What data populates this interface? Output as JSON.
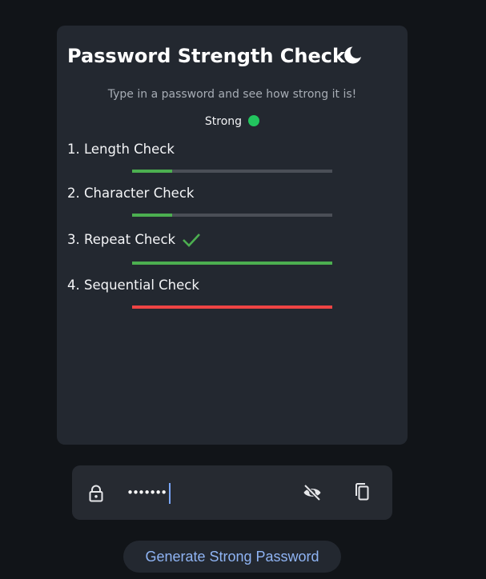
{
  "card": {
    "title": "Password Strength Check",
    "subtitle": "Type in a password and see how strong it is!",
    "strength": {
      "label": "Strong",
      "color": "#22c55e"
    },
    "checks": [
      {
        "label": "1. Length Check",
        "progress": 0.2,
        "color": "#4caf50",
        "passed": false
      },
      {
        "label": "2. Character Check",
        "progress": 0.2,
        "color": "#4caf50",
        "passed": false
      },
      {
        "label": "3. Repeat Check",
        "progress": 1.0,
        "color": "#4caf50",
        "passed": true
      },
      {
        "label": "4. Sequential Check",
        "progress": 1.0,
        "color": "#ef4444",
        "passed": false
      }
    ],
    "theme_icon": "moon-icon"
  },
  "password_field": {
    "value": "•••••••",
    "icons": {
      "left": "lock-icon",
      "visibility": "eye-off-icon",
      "copy": "copy-icon"
    }
  },
  "generate_button": {
    "label": "Generate Strong Password",
    "color": "#8fb4f4"
  }
}
